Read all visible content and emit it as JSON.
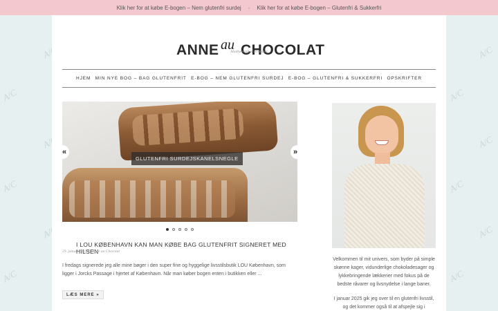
{
  "topbar": {
    "link1": "Klik her for at købe E-bogen – Nem glutenfri surdej",
    "separator": "-",
    "link2": "Klik her for at købe E-bogen – Glutenfri & Sukkerfri"
  },
  "logo": {
    "left": "ANNE",
    "script": "au",
    "right": "CHOCOLAT",
    "tagline": "Madkærlighed en masse"
  },
  "pattern_text": "A/C",
  "nav": [
    {
      "label": "HJEM"
    },
    {
      "label": "MIN NYE BOG – BAG GLUTENFRIT"
    },
    {
      "label": "E-BOG – NEM GLUTENFRI SURDEJ"
    },
    {
      "label": "E-BOG – GLUTENFRI & SUKKERFRI"
    },
    {
      "label": "OPSKRIFTER"
    }
  ],
  "slider": {
    "caption": "GLUTENFRI SURDEJSKANELSNEGLE",
    "prev": "«",
    "next": "»",
    "slide_count": 5,
    "active_slide": 1
  },
  "post": {
    "title": "I LOU KØBENHAVN KAN MAN KØBE BAG GLUTENFRIT SIGNERET MED HILSEN",
    "meta": "29. januar 2025 by Anne au Chocolat",
    "excerpt": "I fredags signerede jeg alle mine bøger i den super fine og hyggelige livsstilsbutik LOU København, som ligger i Jorcks Passage i hjertet af København. Når man køber bogen enten i butikken eller ...",
    "read_more": "LÆS MERE »"
  },
  "sidebar": {
    "intro": "Velkommen til mit univers, som byder på simple skønne kager, vidunderlige chokoladesager og lykkebringende lækkerier med fokus på de bedste råvarer og livsnydelse i lange baner.",
    "text2": "I januar 2025 gik jeg over til en glutenfri livsstil, og det kommer også til at afspejle sig i fremtidige"
  }
}
